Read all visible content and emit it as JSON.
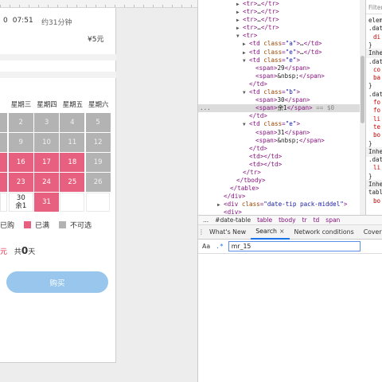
{
  "preview": {
    "start_time_partial": "0",
    "clock": "07:51",
    "duration": "约31分钟",
    "price": "¥5元",
    "weekdays": [
      "",
      "星期三",
      "星期四",
      "星期五",
      "星期六"
    ],
    "weeks": [
      [
        {
          "t": "",
          "s": "grey"
        },
        {
          "t": "2",
          "s": "grey"
        },
        {
          "t": "3",
          "s": "grey"
        },
        {
          "t": "4",
          "s": "grey"
        },
        {
          "t": "5",
          "s": "grey"
        }
      ],
      [
        {
          "t": "",
          "s": "grey"
        },
        {
          "t": "9",
          "s": "grey"
        },
        {
          "t": "10",
          "s": "grey"
        },
        {
          "t": "11",
          "s": "grey"
        },
        {
          "t": "12",
          "s": "grey"
        }
      ],
      [
        {
          "t": "",
          "s": "pink"
        },
        {
          "t": "16",
          "s": "pink"
        },
        {
          "t": "17",
          "s": "pink"
        },
        {
          "t": "18",
          "s": "pink"
        },
        {
          "t": "19",
          "s": "grey"
        }
      ],
      [
        {
          "t": "",
          "s": "pink"
        },
        {
          "t": "23",
          "s": "pink"
        },
        {
          "t": "24",
          "s": "pink"
        },
        {
          "t": "25",
          "s": "pink"
        },
        {
          "t": "26",
          "s": "grey"
        }
      ],
      [
        {
          "t": "",
          "s": "white"
        },
        {
          "t": "30",
          "sub": "余1",
          "s": "white"
        },
        {
          "t": "31",
          "s": "pink"
        },
        {
          "t": "",
          "s": "empty"
        },
        {
          "t": "",
          "s": "empty"
        }
      ]
    ],
    "legend": {
      "bought": "已购",
      "full": "已满",
      "unavailable": "不可选",
      "full_color": "#e8607f",
      "unavailable_color": "#b3b3b3"
    },
    "summary_prefix_red": "元",
    "summary_total_label": "共",
    "summary_days": "0",
    "summary_days_unit": "天",
    "buy_button": "购买"
  },
  "devtools": {
    "tree": [
      {
        "indent": 56,
        "arrow": "right",
        "html": "tr_collapsed"
      },
      {
        "indent": 56,
        "arrow": "right",
        "html": "tr_collapsed"
      },
      {
        "indent": 56,
        "arrow": "right",
        "html": "tr_collapsed"
      },
      {
        "indent": 56,
        "arrow": "right",
        "html": "tr_collapsed"
      },
      {
        "indent": 56,
        "arrow": "down",
        "html": "tr_open"
      },
      {
        "indent": 64,
        "arrow": "right",
        "html": "td",
        "cls": "a"
      },
      {
        "indent": 64,
        "arrow": "right",
        "html": "td",
        "cls": "e"
      },
      {
        "indent": 64,
        "arrow": "down",
        "html": "td_open",
        "cls": "e"
      },
      {
        "indent": 72,
        "arrow": "",
        "html": "span",
        "text": "29"
      },
      {
        "indent": 72,
        "arrow": "",
        "html": "span",
        "text": "&nbsp;"
      },
      {
        "indent": 64,
        "arrow": "",
        "html": "close",
        "tag": "td"
      },
      {
        "indent": 64,
        "arrow": "down",
        "html": "td_open",
        "cls": "b"
      },
      {
        "indent": 72,
        "arrow": "",
        "html": "span",
        "text": "30"
      },
      {
        "indent": 72,
        "arrow": "",
        "html": "span_sel",
        "text": "余1"
      },
      {
        "indent": 64,
        "arrow": "",
        "html": "close",
        "tag": "td"
      },
      {
        "indent": 64,
        "arrow": "down",
        "html": "td_open",
        "cls": "e"
      },
      {
        "indent": 72,
        "arrow": "",
        "html": "span",
        "text": "31"
      },
      {
        "indent": 72,
        "arrow": "",
        "html": "span",
        "text": "&nbsp;"
      },
      {
        "indent": 64,
        "arrow": "",
        "html": "close",
        "tag": "td"
      },
      {
        "indent": 64,
        "arrow": "",
        "html": "empty_td"
      },
      {
        "indent": 64,
        "arrow": "",
        "html": "empty_td"
      },
      {
        "indent": 56,
        "arrow": "",
        "html": "close",
        "tag": "tr"
      },
      {
        "indent": 48,
        "arrow": "",
        "html": "close",
        "tag": "tbody"
      },
      {
        "indent": 40,
        "arrow": "",
        "html": "close",
        "tag": "table"
      },
      {
        "indent": 32,
        "arrow": "",
        "html": "close",
        "tag": "div"
      },
      {
        "indent": 32,
        "arrow": "right",
        "html": "div_tip"
      },
      {
        "indent": 32,
        "arrow": "",
        "html": "div_partial"
      }
    ],
    "selected_suffix": "== $0",
    "div_tip_class": "date-tip pack-middel",
    "styles_filter": "Filter",
    "styles_rows": [
      "eleme",
      ".date",
      "di",
      "}",
      "Inheri",
      ".date",
      "co",
      "ba",
      "}",
      ".date",
      "fo",
      "fo",
      "li",
      "te",
      "bo",
      "}",
      "Inheri",
      ".data",
      "li",
      "}",
      "Inheri",
      "table",
      "bo"
    ],
    "breadcrumbs": [
      "...",
      "#date-table",
      "table",
      "tbody",
      "tr",
      "td",
      "span"
    ],
    "drawer_tabs": [
      "What's New",
      "Search",
      "Network conditions",
      "Covera"
    ],
    "active_drawer_tab": "Search",
    "search_aa": "Aa",
    "search_regex": ".*",
    "search_query": "mr_15"
  }
}
